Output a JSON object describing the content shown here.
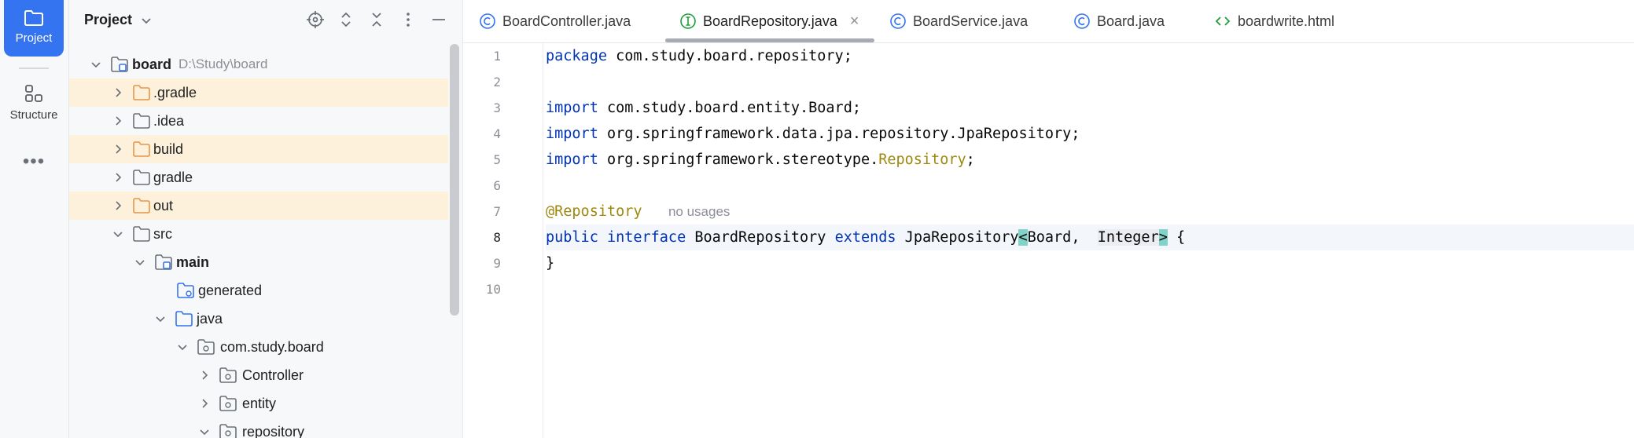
{
  "activity_bar": {
    "project_label": "Project",
    "structure_label": "Structure",
    "more_label": "•••"
  },
  "project_panel": {
    "title": "Project",
    "tree": [
      {
        "label": "board",
        "path": "D:\\Study\\board",
        "bold": true
      },
      {
        "label": ".gradle"
      },
      {
        "label": ".idea"
      },
      {
        "label": "build"
      },
      {
        "label": "gradle"
      },
      {
        "label": "out"
      },
      {
        "label": "src"
      },
      {
        "label": "main",
        "bold": true
      },
      {
        "label": "generated"
      },
      {
        "label": "java"
      },
      {
        "label": "com.study.board"
      },
      {
        "label": "Controller"
      },
      {
        "label": "entity"
      },
      {
        "label": "repository"
      }
    ]
  },
  "editor": {
    "tabs": [
      {
        "label": "BoardController.java",
        "icon": "class-icon"
      },
      {
        "label": "BoardRepository.java",
        "icon": "interface-icon",
        "active": true,
        "close": "×"
      },
      {
        "label": "BoardService.java",
        "icon": "class-icon"
      },
      {
        "label": "Board.java",
        "icon": "class-icon"
      },
      {
        "label": "boardwrite.html",
        "icon": "html-icon"
      }
    ],
    "line_numbers": [
      "1",
      "2",
      "3",
      "4",
      "5",
      "6",
      "7",
      "8",
      "9",
      "10"
    ],
    "code": {
      "l1_kw": "package",
      "l1_rest": " com.study.board.repository;",
      "l3_kw": "import",
      "l3_rest": " com.study.board.entity.Board;",
      "l4_kw": "import",
      "l4_rest": " org.springframework.data.jpa.repository.JpaRepository;",
      "l5_kw": "import",
      "l5_rest": " org.springframework.stereotype.",
      "l5_ann": "Repository",
      "l5_end": ";",
      "l7_ann": "@Repository",
      "l7_hint": "no usages",
      "l8_kw1": "public",
      "l8_kw2": "interface",
      "l8_name": " BoardRepository ",
      "l8_kw3": "extends",
      "l8_type": " JpaRepository",
      "l8_lt": "<",
      "l8_board": "Board,  ",
      "l8_int": "Integer",
      "l8_gt": ">",
      "l8_end": " {",
      "l9": "}"
    }
  },
  "colors": {
    "accent": "#3574f0",
    "keyword": "#0033b3",
    "annotation": "#9e880d",
    "folder_excluded": "#e8954a",
    "highlight_row": "#fdf1db"
  }
}
